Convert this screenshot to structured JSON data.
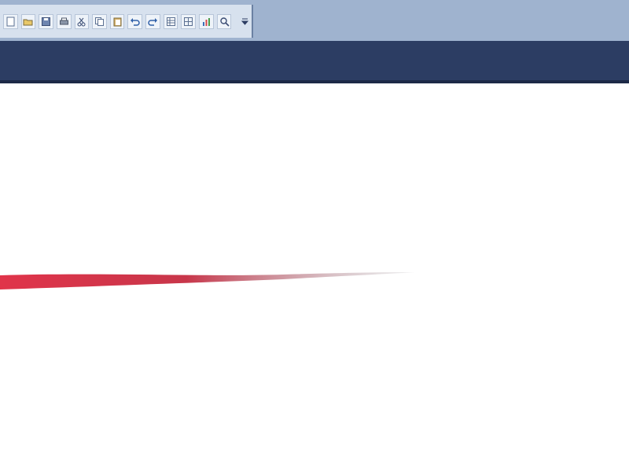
{
  "toolbar": {
    "buttons": [
      {
        "icon": "new-icon"
      },
      {
        "icon": "open-icon"
      },
      {
        "icon": "save-icon"
      },
      {
        "icon": "print-icon"
      },
      {
        "icon": "cut-icon"
      },
      {
        "icon": "copy-icon"
      },
      {
        "icon": "paste-icon"
      },
      {
        "icon": "undo-icon"
      },
      {
        "icon": "redo-icon"
      },
      {
        "icon": "table-icon"
      },
      {
        "icon": "grid-icon"
      },
      {
        "icon": "chart-icon"
      },
      {
        "icon": "zoom-icon"
      }
    ],
    "overflow_icon": "chevron-down-icon"
  },
  "colors": {
    "toolbar_bg": "#9fb3cf",
    "toolbar_panel": "#d7e1ee",
    "ribbon": "#2c3d63",
    "stroke_start": "#e0344a",
    "stroke_end": "#9a9aa0"
  }
}
